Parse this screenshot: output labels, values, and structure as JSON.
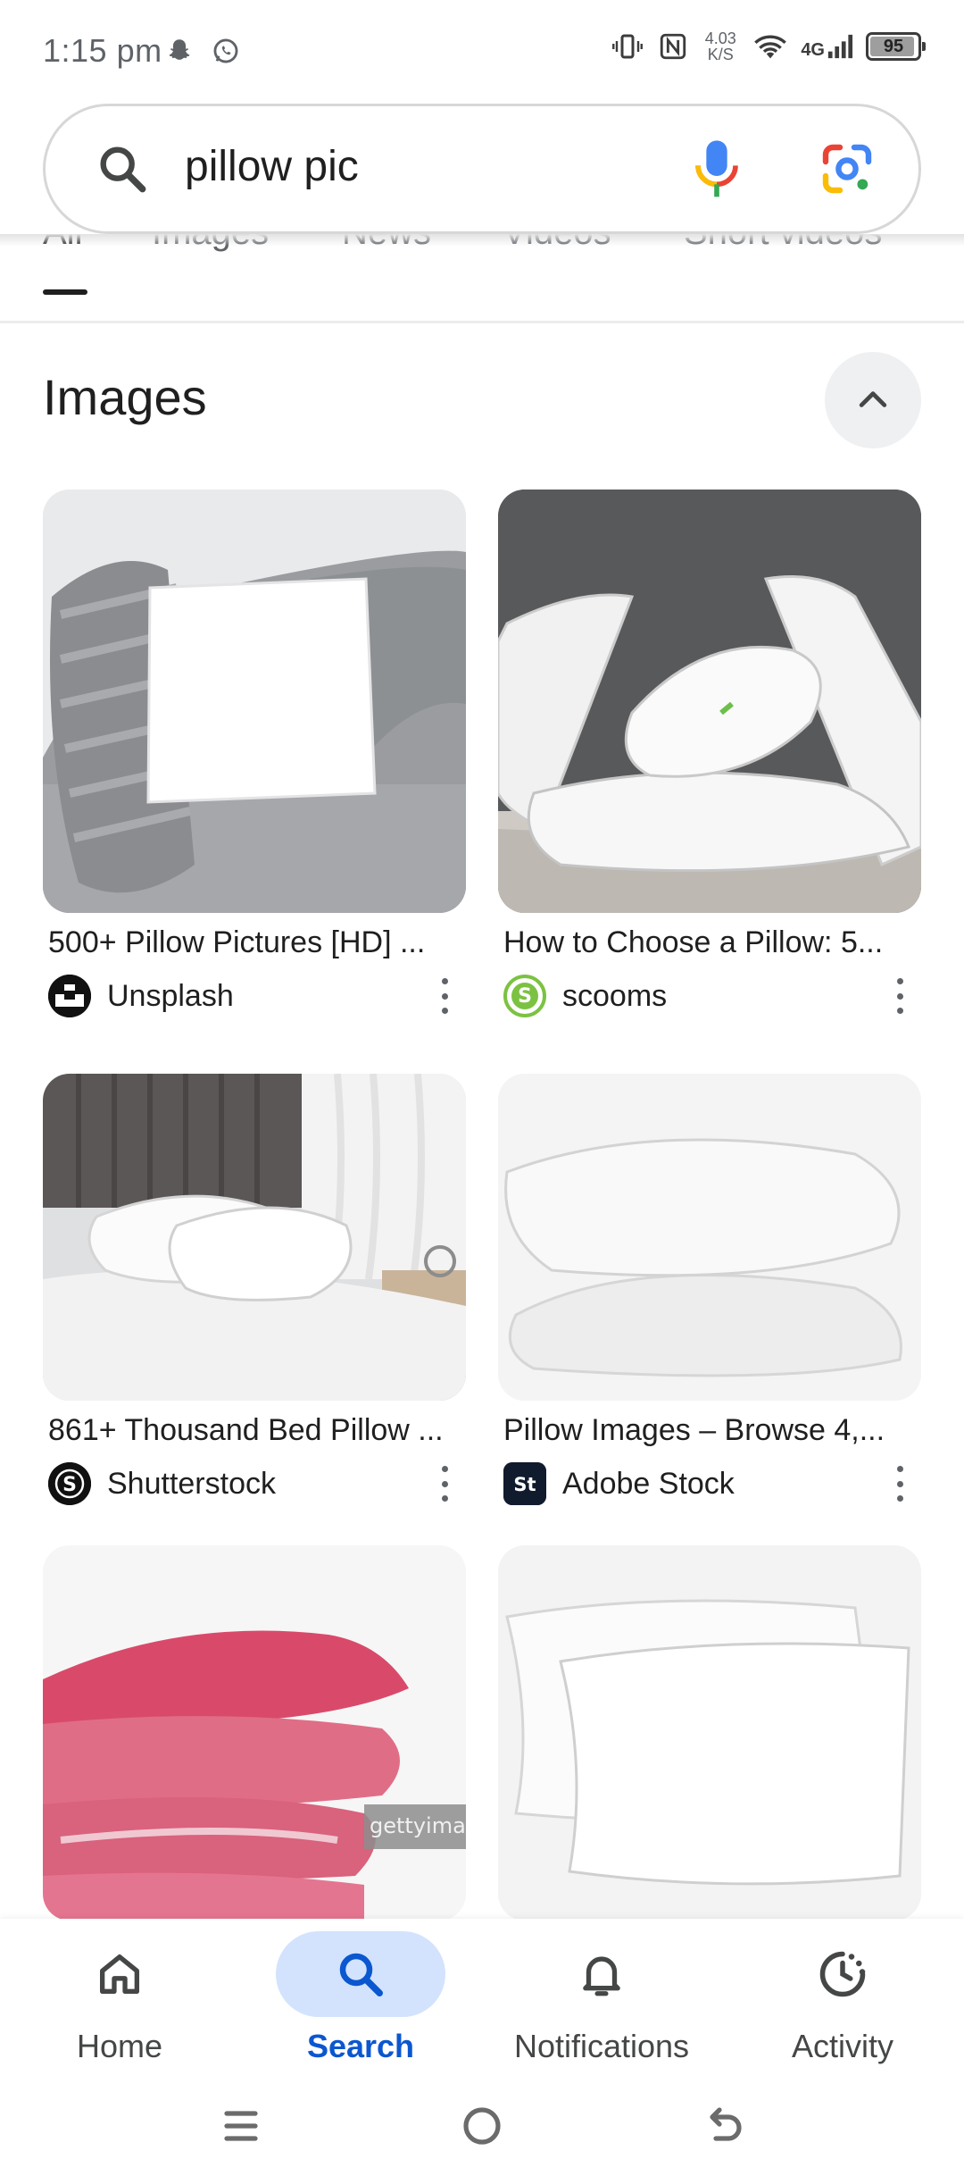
{
  "status_bar": {
    "time": "1:15 pm",
    "net_speed_value": "4.03",
    "net_speed_unit": "K/S",
    "network": "4G",
    "battery": "95",
    "battery_level": 0.95
  },
  "search": {
    "query": "pillow pic",
    "icons": [
      "search-icon",
      "mic-icon",
      "lens-icon"
    ]
  },
  "tabs": [
    "All",
    "Images",
    "News",
    "Videos",
    "Short videos"
  ],
  "active_tab": "All",
  "section": {
    "title": "Images"
  },
  "results": [
    {
      "title": "500+ Pillow Pictures [HD] ...",
      "source": "Unsplash"
    },
    {
      "title": "How to Choose a Pillow: 5...",
      "source": "scooms"
    },
    {
      "title": "861+ Thousand Bed Pillow ...",
      "source": "Shutterstock"
    },
    {
      "title": "Pillow Images – Browse 4,...",
      "source": "Adobe Stock"
    },
    {
      "title": "",
      "source": ""
    },
    {
      "title": "",
      "source": ""
    }
  ],
  "favicon_letters": {
    "shutterstock": "S",
    "adobe": "St",
    "scooms": "S"
  },
  "watermark": "gettyimages",
  "bottom_nav": {
    "home": "Home",
    "search": "Search",
    "notifications": "Notifications",
    "activity": "Activity"
  },
  "colors": {
    "accent": "#0b57d0",
    "active_nav_bg": "#d3e3fd",
    "text": "#1f1f1f",
    "muted": "#5f6368"
  }
}
